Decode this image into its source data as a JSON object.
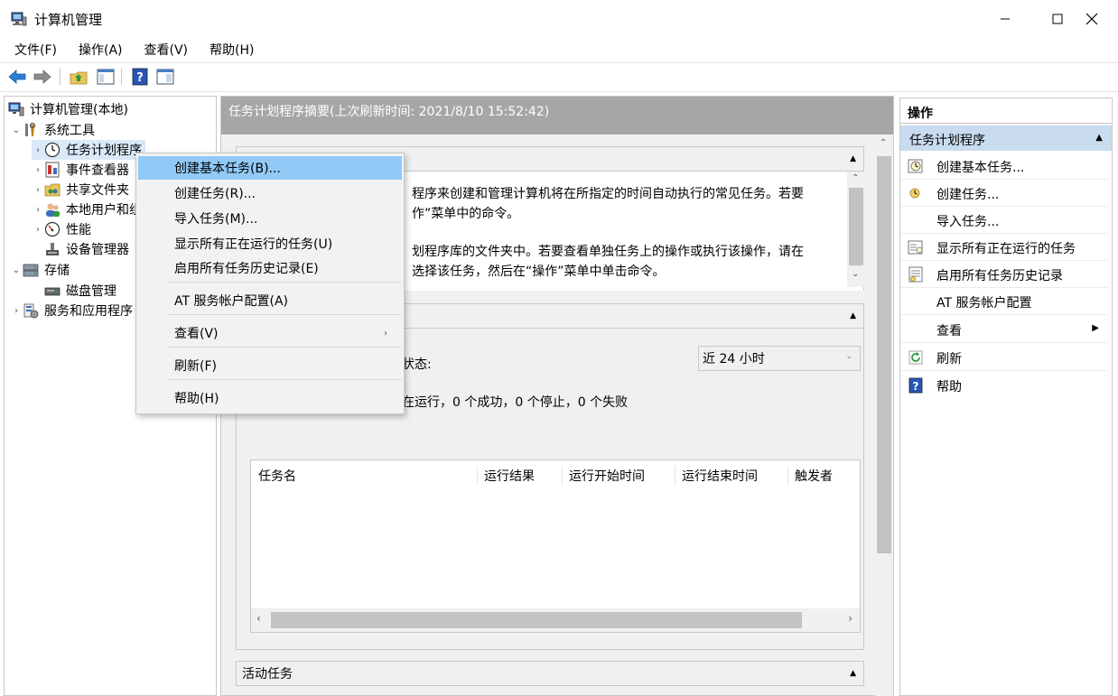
{
  "window": {
    "title": "计算机管理",
    "minimize": "—",
    "maximize": "☐",
    "close": "✕"
  },
  "menubar": {
    "items": [
      "文件(F)",
      "操作(A)",
      "查看(V)",
      "帮助(H)"
    ]
  },
  "toolbar": {
    "icons": [
      "back-arrow-icon",
      "forward-arrow-icon",
      "up-folder-icon",
      "show-hide-tree-icon",
      "help-icon",
      "properties-icon"
    ]
  },
  "tree": {
    "root": "计算机管理(本地)",
    "system_tools": "系统工具",
    "task_scheduler": "任务计划程序",
    "event_viewer": "事件查看器",
    "shared_folders": "共享文件夹",
    "local_users": "本地用户和组",
    "performance": "性能",
    "device_manager": "设备管理器",
    "storage": "存储",
    "disk_management": "磁盘管理",
    "services_apps": "服务和应用程序"
  },
  "center": {
    "header": "任务计划程序摘要(上次刷新时间: 2021/8/10 15:52:42)",
    "overview_lines": [
      "程序来创建和管理计算机将在所指定的时间自动执行的常见任务。若要",
      "作”菜单中的命令。",
      "",
      "划程序库的文件夹中。若要查看单独任务上的操作或执行该操作，请在",
      "选择该任务，然后在“操作”菜单中单击命令。"
    ],
    "status_label": "状态:",
    "status_summary": "在运行，0 个成功，0 个停止，0 个失败",
    "range_value": "近 24 小时",
    "grid_columns": [
      "任务名",
      "运行结果",
      "运行开始时间",
      "运行结束时间",
      "触发者"
    ],
    "active_tasks": "活动任务"
  },
  "actions": {
    "title": "操作",
    "group": "任务计划程序",
    "items": [
      {
        "label": "创建基本任务...",
        "icon": "basic-task-icon"
      },
      {
        "label": "创建任务...",
        "icon": "create-task-icon"
      },
      {
        "label": "导入任务...",
        "icon": ""
      },
      {
        "label": "显示所有正在运行的任务",
        "icon": "running-tasks-icon"
      },
      {
        "label": "启用所有任务历史记录",
        "icon": "history-icon"
      },
      {
        "label": "AT 服务帐户配置",
        "icon": ""
      },
      {
        "label": "查看",
        "icon": ""
      },
      {
        "label": "刷新",
        "icon": "refresh-icon"
      },
      {
        "label": "帮助",
        "icon": "help-icon"
      }
    ]
  },
  "context_menu": {
    "items": [
      "创建基本任务(B)...",
      "创建任务(R)...",
      "导入任务(M)...",
      "显示所有正在运行的任务(U)",
      "启用所有任务历史记录(E)",
      "AT 服务帐户配置(A)",
      "查看(V)",
      "刷新(F)",
      "帮助(H)"
    ]
  },
  "colors": {
    "highlight": "#91c9f7",
    "header_gray": "#a6a6a6",
    "action_group": "#c9dcef"
  }
}
